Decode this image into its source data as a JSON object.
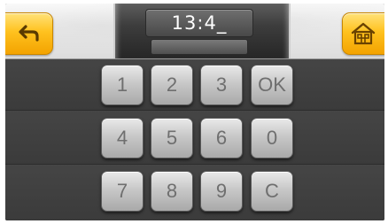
{
  "display": {
    "time_value": "13:4_",
    "sub_value": ""
  },
  "keypad": {
    "keys": [
      "1",
      "2",
      "3",
      "OK",
      "4",
      "5",
      "6",
      "0",
      "7",
      "8",
      "9",
      "C"
    ]
  },
  "icons": {
    "back": "back-arrow-icon",
    "home": "home-icon"
  },
  "colors": {
    "accent": "#ffc21f",
    "background": "#3a3a3a"
  }
}
